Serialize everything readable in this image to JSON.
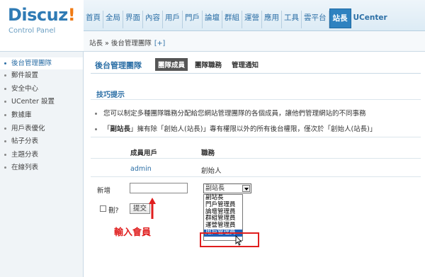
{
  "logo": {
    "brand": "Discuz",
    "bang": "!",
    "subtitle": "Control Panel"
  },
  "topnav": {
    "tabs": [
      "首頁",
      "全局",
      "界面",
      "內容",
      "用戶",
      "門戶",
      "論壇",
      "群組",
      "運營",
      "應用",
      "工具",
      "雲平台",
      "站長",
      "UCenter"
    ],
    "active": "站長"
  },
  "breadcrumb": {
    "path": "站長 » 後台管理團隊",
    "plus": "[+]"
  },
  "sidebar": {
    "items": [
      {
        "label": "後台管理團隊",
        "active": true
      },
      {
        "label": "郵件設置"
      },
      {
        "label": "安全中心"
      },
      {
        "label": "UCenter 設置"
      },
      {
        "label": "數據庫"
      },
      {
        "label": "用戶表優化"
      },
      {
        "label": "帖子分表"
      },
      {
        "label": "主題分表"
      },
      {
        "label": "在線列表"
      }
    ]
  },
  "main": {
    "title": "後台管理團隊",
    "subtabs": [
      "團隊成員",
      "團隊職務",
      "管理通知"
    ],
    "tips_title": "技巧提示",
    "tip1": "您可以制定多種團隊職務分配給您網站管理團隊的各個成員，讓他們管理網站的不同事務",
    "tip2_pre": "「",
    "tip2_bold": "副站長",
    "tip2_post": "」擁有除「創始人(站長)」專有權限以外的所有後台權限，僅次於「創始人(站長)」",
    "col_member": "成員用戶",
    "col_role": "職務",
    "row": {
      "member": "admin",
      "role": "創始人"
    },
    "new_label": "新增",
    "member_input": {
      "value": "",
      "placeholder": ""
    },
    "role_select": "副站長",
    "dropdown": [
      "副站長",
      "門戶管理員",
      "論壇管理員",
      "群組管理員",
      "運營管理員",
      "用戶管理員"
    ],
    "dropdown_selected": "用戶管理員",
    "delete_label": "刪?",
    "submit_label": "提交",
    "annotation": "輸入會員"
  },
  "colors": {
    "accent": "#2f82c0",
    "highlight": "#e01e1e"
  }
}
